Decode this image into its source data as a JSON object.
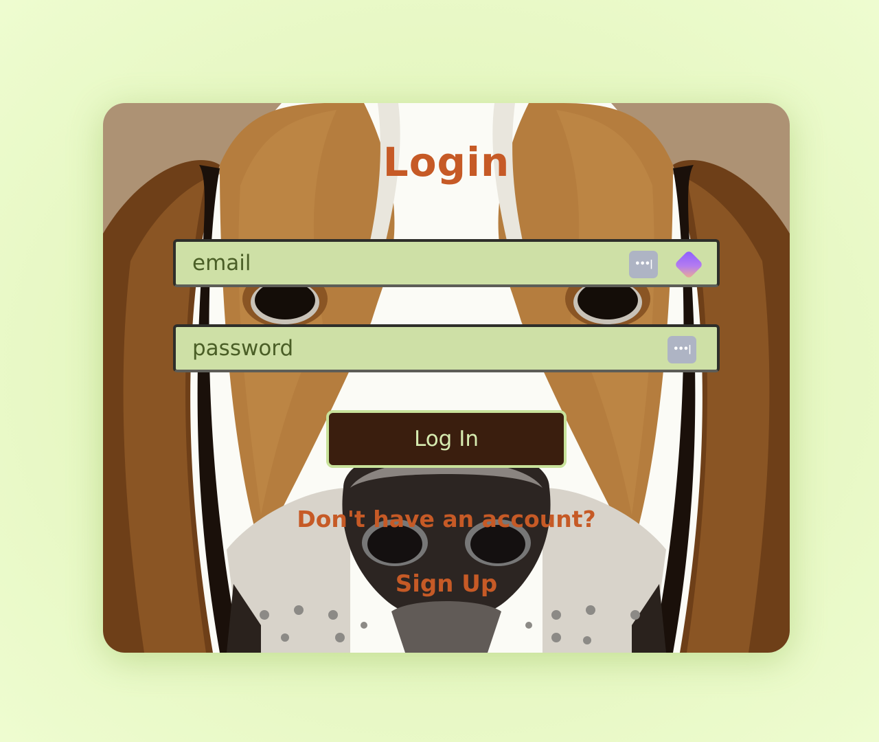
{
  "login": {
    "title": "Login",
    "email_placeholder": "email",
    "password_placeholder": "password",
    "submit_label": "Log In",
    "signup_prompt": "Don't have an account?",
    "signup_link": "Sign Up",
    "password_manager_badge": "•••|"
  },
  "colors": {
    "page_background": "#e6f7c2",
    "title": "#c65a26",
    "field_background": "#cee0a6",
    "field_text": "#4a5e26",
    "button_background": "#3a1e0e",
    "button_text": "#d6ebb0",
    "button_border": "#c8e29a",
    "link": "#c65a26"
  },
  "icons": {
    "password_manager": "password-dots-icon",
    "extension": "gem-extension-icon",
    "background_art": "beagle-face-illustration"
  }
}
